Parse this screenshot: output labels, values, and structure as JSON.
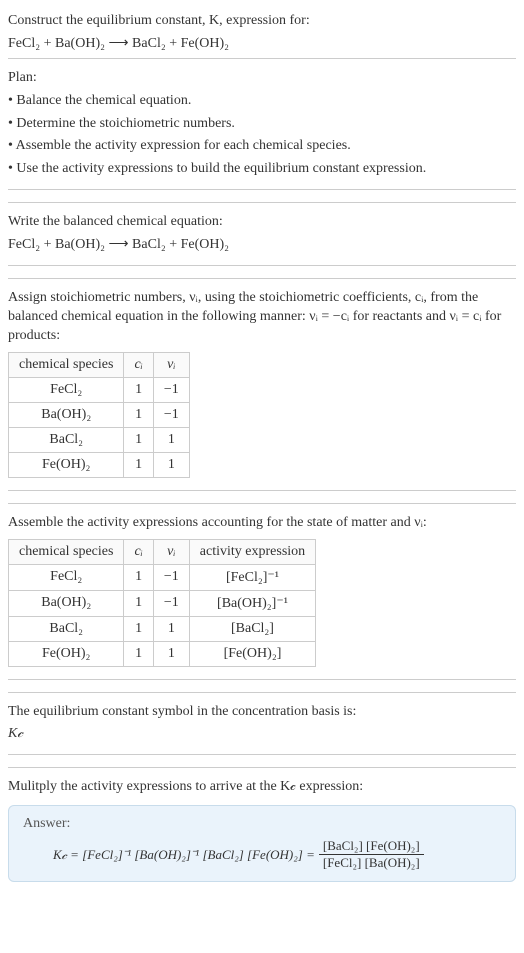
{
  "header": {
    "title_line1": "Construct the equilibrium constant, K, expression for:",
    "equation": "FeCl₂ + Ba(OH)₂ ⟶ BaCl₂ + Fe(OH)₂"
  },
  "plan": {
    "heading": "Plan:",
    "items": [
      "• Balance the chemical equation.",
      "• Determine the stoichiometric numbers.",
      "• Assemble the activity expression for each chemical species.",
      "• Use the activity expressions to build the equilibrium constant expression."
    ]
  },
  "balanced": {
    "heading": "Write the balanced chemical equation:",
    "equation": "FeCl₂ + Ba(OH)₂ ⟶ BaCl₂ + Fe(OH)₂"
  },
  "assign": {
    "text": "Assign stoichiometric numbers, νᵢ, using the stoichiometric coefficients, cᵢ, from the balanced chemical equation in the following manner: νᵢ = −cᵢ for reactants and νᵢ = cᵢ for products:",
    "table_headers": [
      "chemical species",
      "cᵢ",
      "νᵢ"
    ],
    "rows": [
      {
        "species": "FeCl₂",
        "c": "1",
        "v": "−1"
      },
      {
        "species": "Ba(OH)₂",
        "c": "1",
        "v": "−1"
      },
      {
        "species": "BaCl₂",
        "c": "1",
        "v": "1"
      },
      {
        "species": "Fe(OH)₂",
        "c": "1",
        "v": "1"
      }
    ]
  },
  "assemble": {
    "text": "Assemble the activity expressions accounting for the state of matter and νᵢ:",
    "table_headers": [
      "chemical species",
      "cᵢ",
      "νᵢ",
      "activity expression"
    ],
    "rows": [
      {
        "species": "FeCl₂",
        "c": "1",
        "v": "−1",
        "act": "[FeCl₂]⁻¹"
      },
      {
        "species": "Ba(OH)₂",
        "c": "1",
        "v": "−1",
        "act": "[Ba(OH)₂]⁻¹"
      },
      {
        "species": "BaCl₂",
        "c": "1",
        "v": "1",
        "act": "[BaCl₂]"
      },
      {
        "species": "Fe(OH)₂",
        "c": "1",
        "v": "1",
        "act": "[Fe(OH)₂]"
      }
    ]
  },
  "symbol": {
    "text": "The equilibrium constant symbol in the concentration basis is:",
    "sym": "K𝒸"
  },
  "multiply": {
    "text": "Mulitply the activity expressions to arrive at the K𝒸 expression:"
  },
  "answer": {
    "label": "Answer:",
    "lhs": "K𝒸 = [FeCl₂]⁻¹ [Ba(OH)₂]⁻¹ [BaCl₂] [Fe(OH)₂] =",
    "frac_num": "[BaCl₂] [Fe(OH)₂]",
    "frac_den": "[FeCl₂] [Ba(OH)₂]"
  }
}
